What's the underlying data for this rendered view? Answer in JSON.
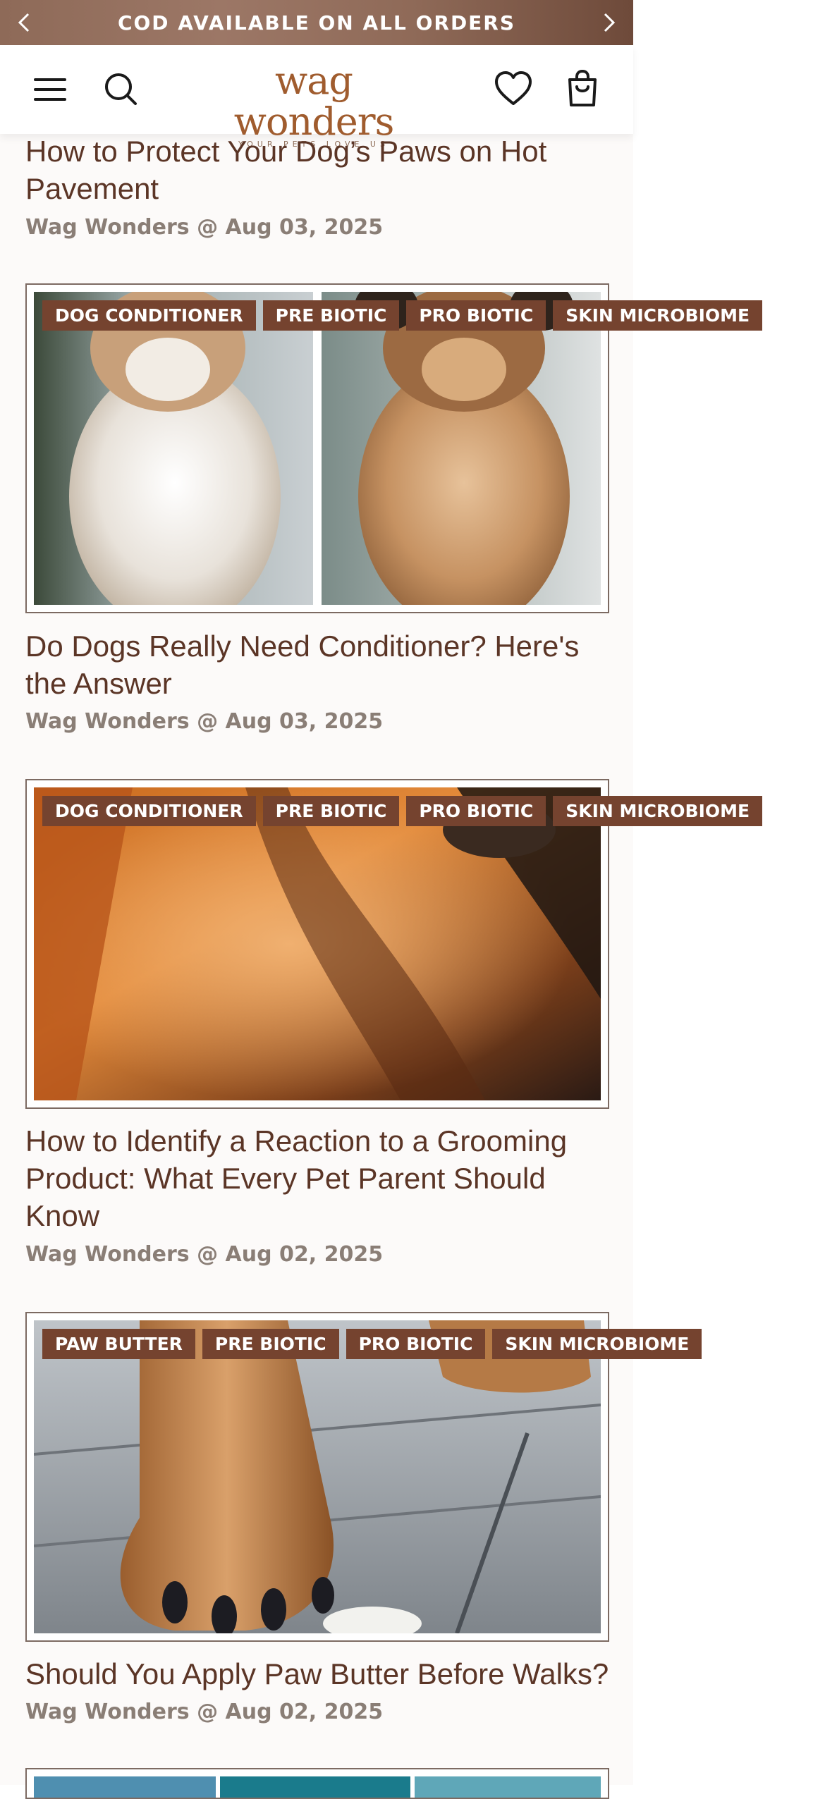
{
  "announcement": {
    "text": "COD AVAILABLE ON ALL ORDERS"
  },
  "header": {
    "brand": "wag wonders",
    "tagline": "YOUR PETS LOVE US"
  },
  "posts": [
    {
      "title": "How to Protect Your Dog’s Paws on Hot Pavement",
      "meta": "Wag Wonders @ Aug 03, 2025"
    },
    {
      "tags": [
        "DOG CONDITIONER",
        "PRE BIOTIC",
        "PRO BIOTIC",
        "SKIN MICROBIOME"
      ],
      "title": "Do Dogs Really Need Conditioner? Here's the Answer",
      "meta": "Wag Wonders @ Aug 03, 2025"
    },
    {
      "tags": [
        "DOG CONDITIONER",
        "PRE BIOTIC",
        "PRO BIOTIC",
        "SKIN MICROBIOME"
      ],
      "title": "How to Identify a Reaction to a Grooming Product: What Every Pet Parent Should Know",
      "meta": "Wag Wonders @ Aug 02, 2025"
    },
    {
      "tags": [
        "PAW BUTTER",
        "PRE BIOTIC",
        "PRO BIOTIC",
        "SKIN MICROBIOME"
      ],
      "title": "Should You Apply Paw Butter Before Walks?",
      "meta": "Wag Wonders @ Aug 02, 2025"
    }
  ],
  "colors": {
    "brand_brown": "#75432f",
    "title_text": "#5b3526",
    "meta_text": "#8a7e76"
  },
  "icons": [
    "chevron-left-icon",
    "chevron-right-icon",
    "menu-icon",
    "search-icon",
    "heart-icon",
    "shopping-bag-icon"
  ]
}
